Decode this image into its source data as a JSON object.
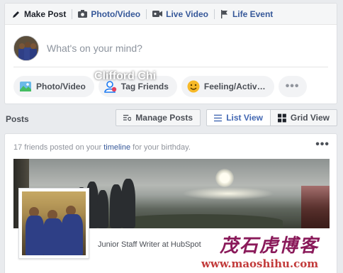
{
  "composer": {
    "tabs": [
      {
        "label": "Make Post",
        "icon": "pencil-icon"
      },
      {
        "label": "Photo/Video",
        "icon": "camera-icon"
      },
      {
        "label": "Live Video",
        "icon": "video-camera-icon"
      },
      {
        "label": "Life Event",
        "icon": "flag-icon"
      }
    ],
    "placeholder": "What's on your mind?",
    "actions": [
      {
        "label": "Photo/Video",
        "icon": "photo-icon",
        "color": "#45bd62"
      },
      {
        "label": "Tag Friends",
        "icon": "tag-friends-icon",
        "color": "#1877f2"
      },
      {
        "label": "Feeling/Activ…",
        "icon": "smiley-icon",
        "color": "#f7b928"
      },
      {
        "label": "•••",
        "icon": "more-icon"
      }
    ]
  },
  "posts_bar": {
    "title": "Posts",
    "manage_label": "Manage Posts",
    "list_view_label": "List View",
    "grid_view_label": "Grid View"
  },
  "post": {
    "intro_prefix": "17 friends posted on your ",
    "intro_link": "timeline",
    "intro_suffix": " for your birthday.",
    "more": "•••",
    "name": "Clifford Chi",
    "job": "Junior Staff Writer at HubSpot"
  },
  "watermark": {
    "text": "茂石虎博客",
    "url": "www.maoshihu.com"
  },
  "colors": {
    "link": "#365899",
    "accent": "#4267b2",
    "background": "#e9ebee"
  }
}
